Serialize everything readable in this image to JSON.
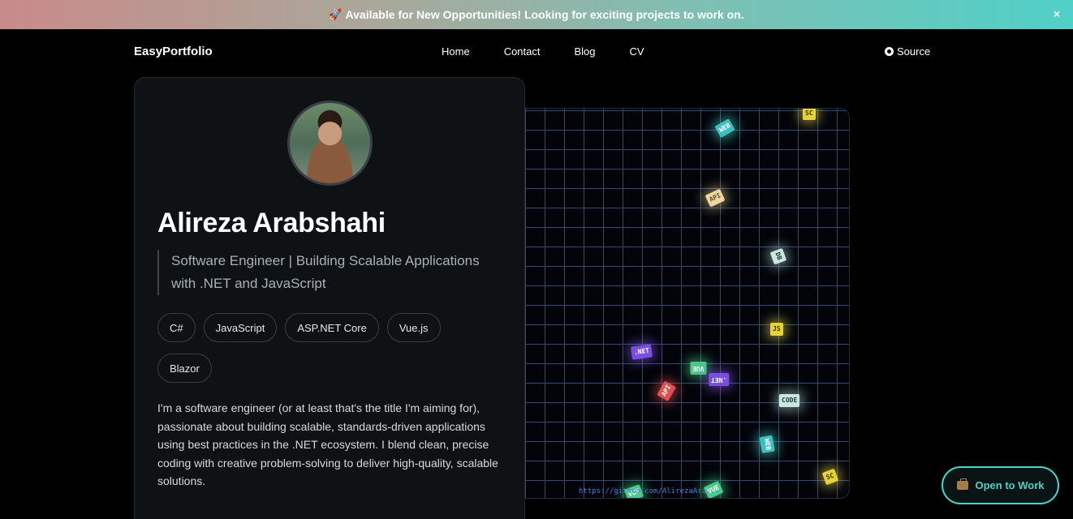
{
  "banner": {
    "rocket_icon": "🚀",
    "text": "Available for New Opportunities! Looking for exciting projects to work on.",
    "close_label": "×"
  },
  "nav": {
    "brand": "EasyPortfolio",
    "links": [
      "Home",
      "Contact",
      "Blog",
      "CV"
    ],
    "source_label": "Source",
    "source_icon": "github-icon"
  },
  "profile": {
    "name": "Alireza Arabshahi",
    "tagline": "Software Engineer | Building Scalable Applications with .NET and JavaScript",
    "tags": [
      "C#",
      "JavaScript",
      "ASP.NET Core",
      "Vue.js",
      "Blazor"
    ],
    "bio": "I'm a software engineer (or at least that's the title I'm aiming for), passionate about building scalable, standards-driven applications using best practices in the .NET ecosystem. I blend clean, precise coding with creative problem-solving to deliver high-quality, scalable solutions."
  },
  "animation": {
    "chips": [
      ".NET",
      "JS",
      "VUE",
      "CODE",
      "WEB",
      "SC",
      "API",
      "DB"
    ],
    "url_text": "https://github.com/AlirezaAra..."
  },
  "cta": {
    "label": "Open to Work",
    "icon": "briefcase-icon",
    "accent": "#4fd1c8"
  }
}
